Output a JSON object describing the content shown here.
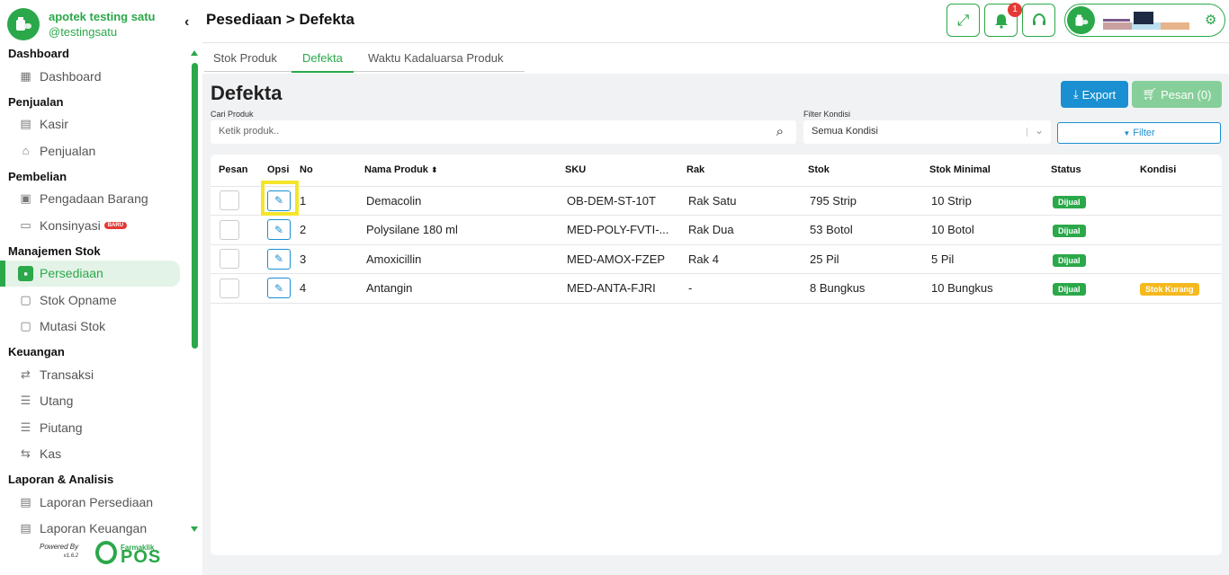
{
  "brand": {
    "name": "apotek testing satu",
    "handle": "@testingsatu"
  },
  "sidebar": {
    "sections": [
      {
        "title": "Dashboard",
        "items": [
          {
            "label": "Dashboard",
            "icon": "grid-icon"
          }
        ]
      },
      {
        "title": "Penjualan",
        "items": [
          {
            "label": "Kasir",
            "icon": "cashier-icon"
          },
          {
            "label": "Penjualan",
            "icon": "shopping-bag-icon"
          }
        ]
      },
      {
        "title": "Pembelian",
        "items": [
          {
            "label": "Pengadaan Barang",
            "icon": "procurement-icon"
          },
          {
            "label": "Konsinyasi",
            "icon": "consignment-icon",
            "badge": "BARU"
          }
        ]
      },
      {
        "title": "Manajemen Stok",
        "items": [
          {
            "label": "Persediaan",
            "icon": "inventory-icon",
            "active": true
          },
          {
            "label": "Stok Opname",
            "icon": "stock-opname-icon"
          },
          {
            "label": "Mutasi Stok",
            "icon": "stock-mutation-icon"
          }
        ]
      },
      {
        "title": "Keuangan",
        "items": [
          {
            "label": "Transaksi",
            "icon": "transaction-icon"
          },
          {
            "label": "Utang",
            "icon": "debt-icon"
          },
          {
            "label": "Piutang",
            "icon": "receivable-icon"
          },
          {
            "label": "Kas",
            "icon": "cash-icon"
          }
        ]
      },
      {
        "title": "Laporan & Analisis",
        "items": [
          {
            "label": "Laporan Persediaan",
            "icon": "inventory-report-icon"
          },
          {
            "label": "Laporan Keuangan",
            "icon": "finance-report-icon"
          }
        ]
      }
    ],
    "powered_by": "Powered By",
    "version": "v1.6.2",
    "pos_small": "Farmaklik",
    "pos_big": "POS"
  },
  "header": {
    "title": "Pesediaan > Defekta",
    "notification_count": "1"
  },
  "tabs": [
    {
      "label": "Stok Produk"
    },
    {
      "label": "Defekta",
      "active": true
    },
    {
      "label": "Waktu Kadaluarsa Produk"
    }
  ],
  "main": {
    "title": "Defekta",
    "export_label": "Export",
    "pesan_label": "Pesan (0)",
    "search_label": "Cari Produk",
    "search_placeholder": "Ketik produk..",
    "filter_label": "Filter Kondisi",
    "filter_value": "Semua Kondisi",
    "filter_button": "Filter"
  },
  "table": {
    "headers": {
      "pesan": "Pesan",
      "opsi": "Opsi",
      "no": "No",
      "nama": "Nama Produk",
      "sku": "SKU",
      "rak": "Rak",
      "stok": "Stok",
      "stok_min": "Stok Minimal",
      "status": "Status",
      "kondisi": "Kondisi"
    },
    "rows": [
      {
        "no": "1",
        "nama": "Demacolin",
        "sku": "OB-DEM-ST-10T",
        "rak": "Rak Satu",
        "stok": "795 Strip",
        "stok_min": "10 Strip",
        "status": "Dijual",
        "kondisi": ""
      },
      {
        "no": "2",
        "nama": "Polysilane 180 ml",
        "sku": "MED-POLY-FVTI-...",
        "rak": "Rak Dua",
        "stok": "53 Botol",
        "stok_min": "10 Botol",
        "status": "Dijual",
        "kondisi": ""
      },
      {
        "no": "3",
        "nama": "Amoxicillin",
        "sku": "MED-AMOX-FZEP",
        "rak": "Rak 4",
        "stok": "25 Pil",
        "stok_min": "5 Pil",
        "status": "Dijual",
        "kondisi": ""
      },
      {
        "no": "4",
        "nama": "Antangin",
        "sku": "MED-ANTA-FJRI",
        "rak": "-",
        "stok": "8 Bungkus",
        "stok_min": "10 Bungkus",
        "status": "Dijual",
        "kondisi": "Stok Kurang"
      }
    ]
  },
  "colors": {
    "brand_green": "#2ba84a",
    "accent_blue": "#1a8fd1",
    "warning": "#f5b91e",
    "danger": "#e53935"
  }
}
